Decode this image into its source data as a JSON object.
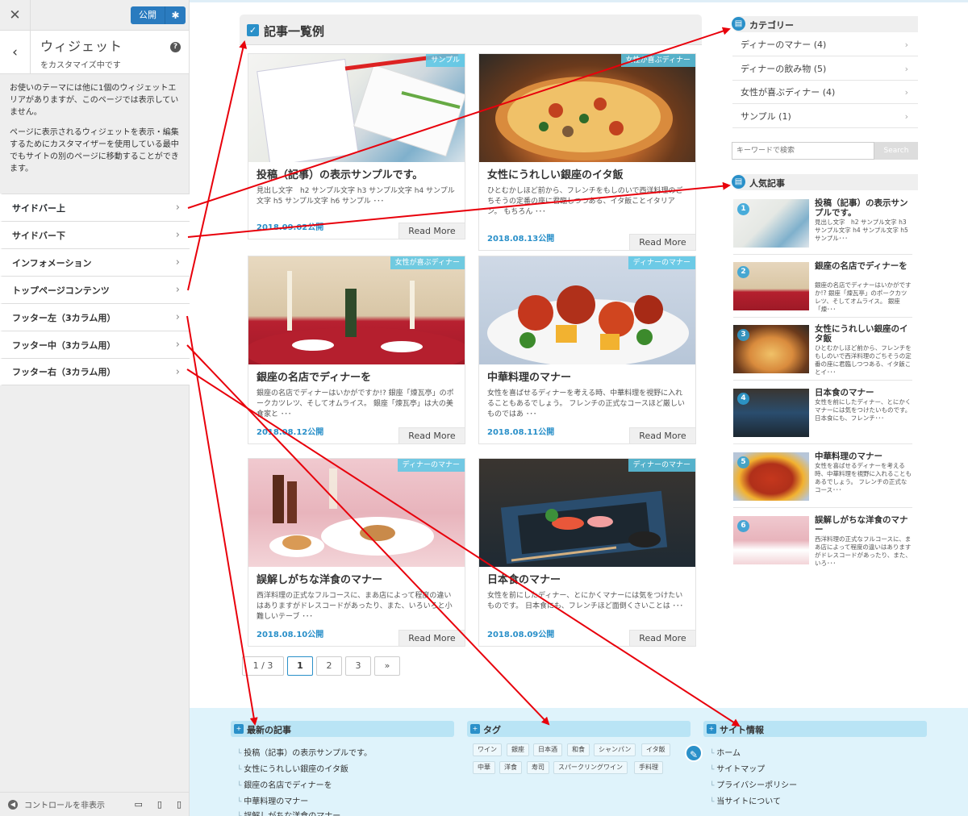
{
  "customizer": {
    "close": "✕",
    "publish": "公開",
    "title": "ウィジェット",
    "subtitle": "をカスタマイズ中です",
    "help": "?",
    "desc1": "お使いのテーマには他に1個のウィジェットエリアがありますが、このページでは表示していません。",
    "desc2": "ページに表示されるウィジェットを表示・編集するためにカスタマイザーを使用している最中でもサイトの別のページに移動することができます。",
    "items": [
      {
        "label": "サイドバー上"
      },
      {
        "label": "サイドバー下"
      },
      {
        "label": "インフォメーション"
      },
      {
        "label": "トップページコンテンツ"
      },
      {
        "label": "フッター左（3カラム用）"
      },
      {
        "label": "フッター中（3カラム用）"
      },
      {
        "label": "フッター右（3カラム用）"
      }
    ],
    "hide_controls": "コントロールを非表示"
  },
  "main": {
    "title": "記事一覧例",
    "read_more": "Read More",
    "cards": [
      {
        "tag": "サンプル",
        "title": "投稿（記事）の表示サンプルです。",
        "excerpt": "見出し文字　h2 サンプル文字 h3 サンプル文字 h4 サンプル文字 h5 サンプル文字 h6 サンプル ･･･",
        "date": "2018.09.02公開"
      },
      {
        "tag": "女性が喜ぶディナー",
        "title": "女性にうれしい銀座のイタ飯",
        "excerpt": "ひとむかしほど前から、フレンチをもしのいで西洋料理のごちそうの定番の座に君臨しつつある、イタ飯ことイタリアン。 もちろん ･･･",
        "date": "2018.08.13公開"
      },
      {
        "tag": "女性が喜ぶディナー",
        "title": "銀座の名店でディナーを",
        "excerpt": "銀座の名店でディナーはいかがですか!? 銀座「煉瓦亭」のポークカツレツ、そしてオムライス。 銀座「煉瓦亭」は大の美食家と ･･･",
        "date": "2018.08.12公開"
      },
      {
        "tag": "ディナーのマナー",
        "title": "中華料理のマナー",
        "excerpt": "女性を喜ばせるディナーを考える時、中華料理を視野に入れることもあるでしょう。 フレンチの正式なコースほど厳しいものではあ ･･･",
        "date": "2018.08.11公開"
      },
      {
        "tag": "ディナーのマナー",
        "title": "誤解しがちな洋食のマナー",
        "excerpt": "西洋料理の正式なフルコースに、まあ店によって程度の違いはありますがドレスコードがあったり、また、いろいろと小難しいテーブ ･･･",
        "date": "2018.08.10公開"
      },
      {
        "tag": "ディナーのマナー",
        "title": "日本食のマナー",
        "excerpt": "女性を前にしたディナー、とにかくマナーには気をつけたいものです。 日本食にも、フレンチほど面倒くさいことは ･･･",
        "date": "2018.08.09公開"
      }
    ],
    "pagination": [
      "1 / 3",
      "1",
      "2",
      "3",
      "»"
    ]
  },
  "sidebar": {
    "category_title": "カテゴリー",
    "categories": [
      "ディナーのマナー (4)",
      "ディナーの飲み物 (5)",
      "女性が喜ぶディナー (4)",
      "サンプル (1)"
    ],
    "search_placeholder": "キーワードで検索",
    "search_button": "Search",
    "popular_title": "人気記事",
    "popular": [
      {
        "rank": "1",
        "title": "投稿（記事）の表示サンプルです。",
        "excerpt": "見出し文字　h2 サンプル文字 h3 サンプル文字 h4 サンプル文字 h5 サンプル･･･"
      },
      {
        "rank": "2",
        "title": "銀座の名店でディナーを",
        "excerpt": "銀座の名店でディナーはいかがですか!? 銀座「煉瓦亭」のポークカツレツ、そしてオムライス。 銀座「煉･･･"
      },
      {
        "rank": "3",
        "title": "女性にうれしい銀座のイタ飯",
        "excerpt": "ひとむかしほど前から、フレンチをもしのいで西洋料理のごちそうの定番の座に君臨しつつある、イタ飯ことイ･･･"
      },
      {
        "rank": "4",
        "title": "日本食のマナー",
        "excerpt": "女性を前にしたディナー、とにかくマナーには気をつけたいものです。 日本食にも、フレンチ･･･"
      },
      {
        "rank": "5",
        "title": "中華料理のマナー",
        "excerpt": "女性を喜ばせるディナーを考える時、中華料理を視野に入れることもあるでしょう。 フレンチの正式なコース･･･"
      },
      {
        "rank": "6",
        "title": "誤解しがちな洋食のマナー",
        "excerpt": "西洋料理の正式なフルコースに、まあ店によって程度の違いはありますがドレスコードがあったり、また、いろ･･･"
      }
    ]
  },
  "footer": {
    "recent_title": "最新の記事",
    "recent": [
      "投稿（記事）の表示サンプルです。",
      "女性にうれしい銀座のイタ飯",
      "銀座の名店でディナーを",
      "中華料理のマナー",
      "誤解しがちな洋食のマナー"
    ],
    "tag_title": "タグ",
    "tags_row1": [
      "ワイン",
      "銀座",
      "日本酒",
      "和食",
      "シャンパン",
      "イタ飯"
    ],
    "tags_row2": [
      "中華",
      "洋食",
      "寿司",
      "スパークリングワイン",
      "手料理"
    ],
    "site_title": "サイト情報",
    "site_links": [
      "ホーム",
      "サイトマップ",
      "プライバシーポリシー",
      "当サイトについて"
    ]
  },
  "colors": {
    "accent": "#2a90c9",
    "arrow": "#e8000b",
    "footer_bg": "#dff3fb"
  }
}
